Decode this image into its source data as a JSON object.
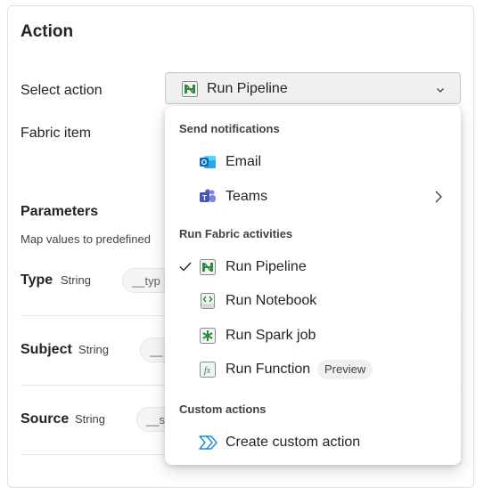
{
  "panel": {
    "title": "Action",
    "select_action_label": "Select action",
    "selected_value": "Run Pipeline",
    "fabric_item_label": "Fabric item",
    "parameters_heading": "Parameters",
    "parameters_description": "Map values to predefined"
  },
  "parameters": [
    {
      "name": "Type",
      "type": "String",
      "value": "__typ"
    },
    {
      "name": "Subject",
      "type": "String",
      "value": "__"
    },
    {
      "name": "Source",
      "type": "String",
      "value": "__s"
    }
  ],
  "menu": {
    "groups": [
      {
        "label": "Send notifications"
      },
      {
        "label": "Run Fabric activities"
      },
      {
        "label": "Custom actions"
      }
    ],
    "items": [
      {
        "label": "Email",
        "icon": "outlook-icon"
      },
      {
        "label": "Teams",
        "icon": "teams-icon",
        "submenu": true
      },
      {
        "label": "Run Pipeline",
        "icon": "pipeline-icon",
        "checked": true
      },
      {
        "label": "Run Notebook",
        "icon": "notebook-icon"
      },
      {
        "label": "Run Spark job",
        "icon": "spark-job-icon"
      },
      {
        "label": "Run Function",
        "icon": "function-icon",
        "badge": "Preview"
      },
      {
        "label": "Create custom action",
        "icon": "custom-action-icon"
      }
    ]
  },
  "colors": {
    "outlook": "#0f6cbd",
    "teams": "#5b5fc7",
    "pipeline_green": "#2e8b3a",
    "custom_action_blue": "#1a8cd8"
  }
}
